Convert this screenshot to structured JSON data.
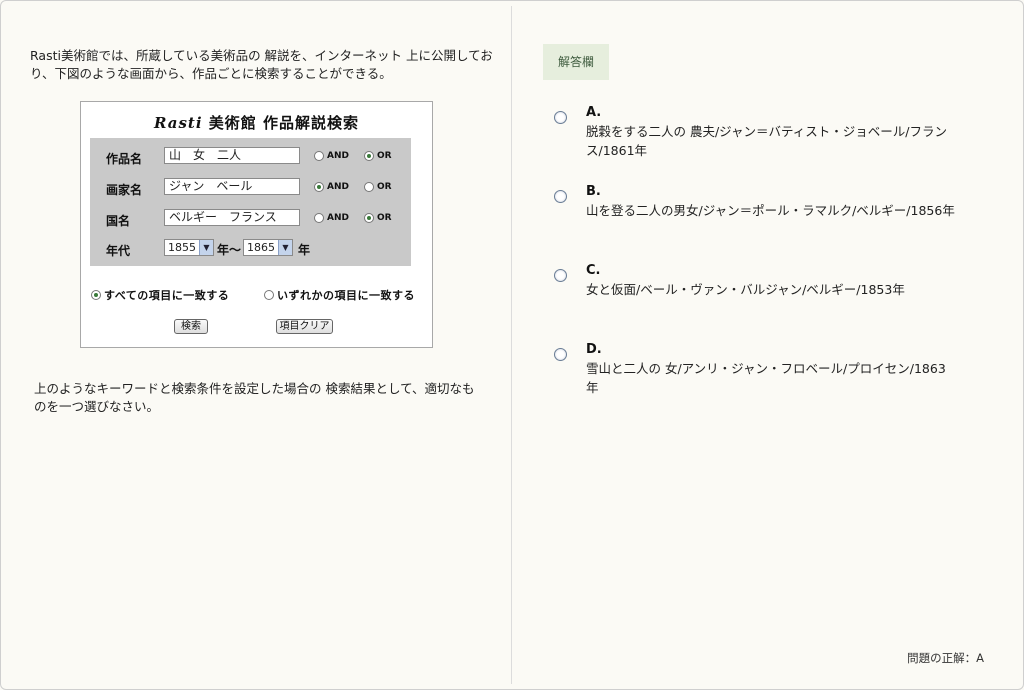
{
  "question": {
    "intro": "Rasti美術館では、所蔵している美術品の 解説を、インターネット 上に公開しており、下図のような画面から、作品ごとに検索することができる。",
    "instruction": "上のようなキーワードと検索条件を設定した場合の 検索結果として、適切なものを一つ選びなさい。"
  },
  "search_form": {
    "title_brand": "Rasti",
    "title_rest": "美術館 作品解説検索",
    "fields": [
      {
        "label": "作品名",
        "value": "山　女　二人",
        "and_label": "AND",
        "or_label": "OR",
        "selected": "or"
      },
      {
        "label": "画家名",
        "value": "ジャン　ベール",
        "and_label": "AND",
        "or_label": "OR",
        "selected": "and"
      },
      {
        "label": "国名",
        "value": "ベルギー　フランス",
        "and_label": "AND",
        "or_label": "OR",
        "selected": "or"
      }
    ],
    "year": {
      "label": "年代",
      "from": "1855",
      "to": "1865",
      "suffix1": "年～",
      "suffix2": "年"
    },
    "match_all": "すべての項目に一致する",
    "match_any": "いずれかの項目に一致する",
    "match_selected": "all",
    "search_button": "検索",
    "clear_button": "項目クリア"
  },
  "answers": {
    "header": "解答欄",
    "choices": [
      {
        "letter": "A.",
        "text": "脱穀をする二人の 農夫/ジャン＝バティスト・ジョベール/フランス/1861年"
      },
      {
        "letter": "B.",
        "text": "山を登る二人の男女/ジャン＝ポール・ラマルク/ベルギー/1856年"
      },
      {
        "letter": "C.",
        "text": "女と仮面/ベール・ヴァン・バルジャン/ベルギー/1853年"
      },
      {
        "letter": "D.",
        "text": "雪山と二人の 女/アンリ・ジャン・フロベール/プロイセン/1863年"
      }
    ],
    "correct": "問題の正解：A"
  }
}
